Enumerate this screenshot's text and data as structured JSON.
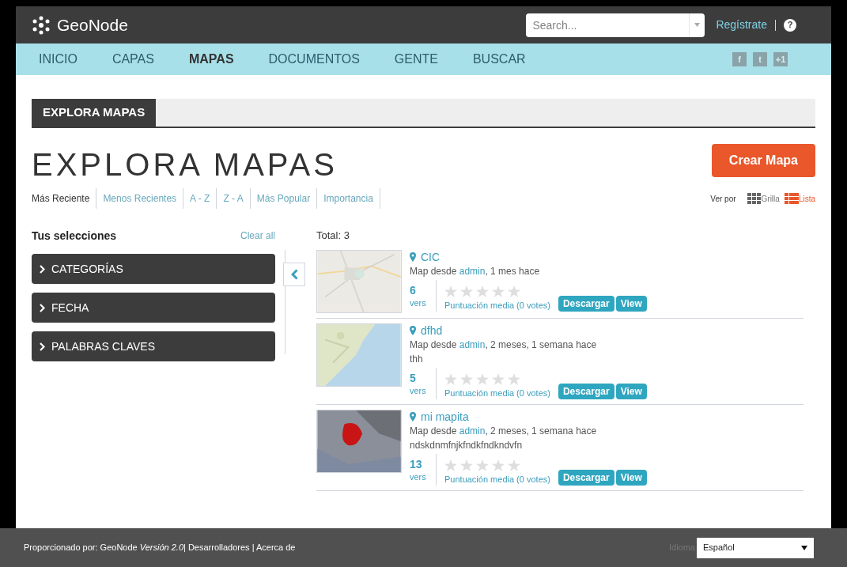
{
  "header": {
    "logo": "GeoNode",
    "search": {
      "placeholder": "Search..."
    },
    "register_link": "Regístrate",
    "help": "?"
  },
  "nav": [
    {
      "label": "INICIO",
      "selected": false
    },
    {
      "label": "CAPAS",
      "selected": false
    },
    {
      "label": "MAPAS",
      "selected": true
    },
    {
      "label": "DOCUMENTOS",
      "selected": false
    },
    {
      "label": "GENTE",
      "selected": false
    },
    {
      "label": "BUSCAR",
      "selected": false
    }
  ],
  "social": [
    "f",
    "t",
    "+1"
  ],
  "breadcrumb": "EXPLORA MAPAS",
  "page_title": "EXPLORA MAPAS",
  "create_button": "Crear Mapa",
  "sort_options": [
    {
      "label": "Más Reciente",
      "selected": true
    },
    {
      "label": "Menos Recientes",
      "selected": false
    },
    {
      "label": "A - Z",
      "selected": false
    },
    {
      "label": "Z - A",
      "selected": false
    },
    {
      "label": "Más Popular",
      "selected": false
    },
    {
      "label": "Importancia",
      "selected": false
    }
  ],
  "view_by": {
    "label": "Ver por",
    "options": [
      {
        "label": "Grilla",
        "kind": "grid",
        "selected": false
      },
      {
        "label": "Lista",
        "kind": "list",
        "selected": true
      }
    ]
  },
  "filters": {
    "title": "Tus selecciones",
    "clear": "Clear all",
    "items": [
      "CATEGORÍAS",
      "FECHA",
      "PALABRAS CLAVES"
    ]
  },
  "total": "Total: 3",
  "maps": [
    {
      "title": "CIC",
      "meta_prefix": "Map desde ",
      "author": "admin",
      "meta_suffix": ", 1 mes hace",
      "views": "6",
      "views_label": "vers",
      "stars": 0,
      "rating": "Puntuación media (0 votes)",
      "download": "Descargar",
      "view": "View",
      "kind": "picture"
    },
    {
      "title": "dfhd",
      "meta_prefix": "Map desde ",
      "author": "admin",
      "meta_suffix": ", 2 meses, 1 semana hace",
      "abstract": "thh",
      "views": "5",
      "views_label": "vers",
      "stars": 0,
      "rating": "Puntuación media (0 votes)",
      "download": "Descargar",
      "view": "View",
      "kind": "picture"
    },
    {
      "title": "mi mapita",
      "meta_prefix": "Map desde ",
      "author": "admin",
      "meta_suffix": ", 2 meses, 1 semana hace",
      "abstract": "ndskdnmfnjkfndkfndkndvfn",
      "views": "13",
      "views_label": "vers",
      "stars": 0,
      "rating": "Puntuación media (0 votes)",
      "download": "Descargar",
      "view": "View",
      "kind": "picture"
    }
  ],
  "footer": {
    "text": "Proporcionado por: GeoNode *Versión 2.0*| Desarrolladores | Acerca de",
    "language_label": "Idioma",
    "language": "Español"
  }
}
